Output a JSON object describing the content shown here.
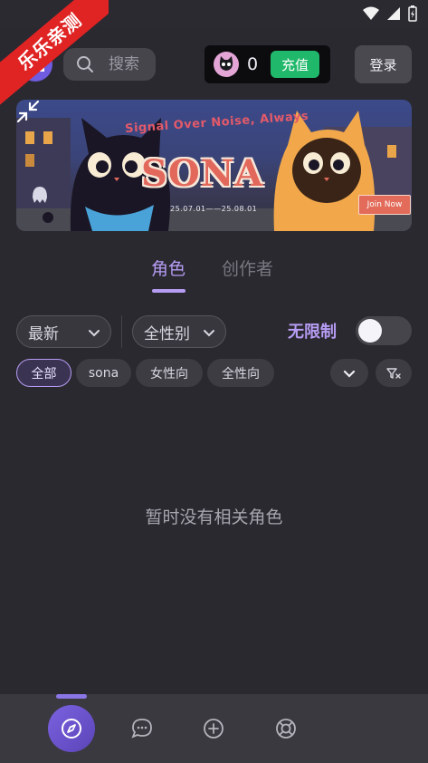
{
  "ribbon": {
    "text": "乐乐亲测"
  },
  "header": {
    "search_placeholder": "搜索",
    "balance": "0",
    "recharge_label": "充值",
    "login_label": "登录"
  },
  "banner": {
    "tagline": "Signal Over Noise, Always",
    "title": "SONA",
    "dates": "25.07.01——25.08.01",
    "join_label": "Join Now"
  },
  "tabs": [
    {
      "label": "角色",
      "active": true
    },
    {
      "label": "创作者",
      "active": false
    }
  ],
  "filters": {
    "sort": "最新",
    "gender": "全性别",
    "unlimited_label": "无限制",
    "unlimited_on": false
  },
  "chips": [
    {
      "label": "全部",
      "active": true
    },
    {
      "label": "sona",
      "active": false
    },
    {
      "label": "女性向",
      "active": false
    },
    {
      "label": "全性向",
      "active": false
    }
  ],
  "empty_message": "暂时没有相关角色",
  "colors": {
    "accent": "#b69cf3",
    "background": "#2a2930",
    "recharge": "#20b86a",
    "ribbon": "#e02323"
  },
  "nav": [
    {
      "icon": "compass-icon",
      "active": true
    },
    {
      "icon": "chat-bubble-icon",
      "active": false
    },
    {
      "icon": "plus-circle-icon",
      "active": false
    },
    {
      "icon": "lifebuoy-icon",
      "active": false
    }
  ]
}
